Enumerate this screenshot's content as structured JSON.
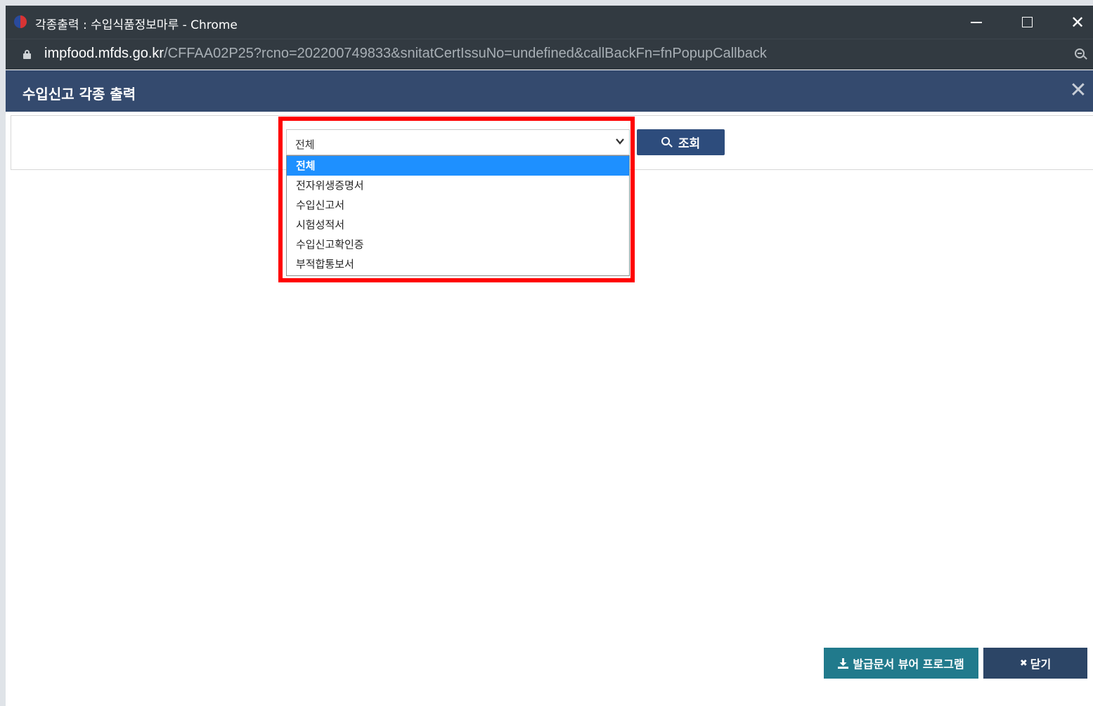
{
  "window": {
    "title": "각종출력 : 수입식품정보마루 - Chrome"
  },
  "addressbar": {
    "domain": "impfood.mfds.go.kr",
    "path": "/CFFAA02P25?rcno=202200749833&snitatCertIssuNo=undefined&callBackFn=fnPopupCallback"
  },
  "modal": {
    "title": "수입신고 각종 출력",
    "close_symbol": "✕"
  },
  "search": {
    "selected_value": "전체",
    "button_label": "조회",
    "options": [
      "전체",
      "전자위생증명서",
      "수입신고서",
      "시험성적서",
      "수입신고확인증",
      "부적합통보서"
    ],
    "highlighted_index": 0
  },
  "footer": {
    "viewer_button_label": "발급문서 뷰어 프로그램",
    "close_button_label": "닫기",
    "close_button_icon": "✖"
  },
  "colors": {
    "titlebar": "#323a41",
    "modal_header": "#344a6e",
    "search_button": "#2d4c7c",
    "viewer_button": "#217a8c",
    "close_button": "#2c4566",
    "highlight_border": "#ff0000",
    "selected_option": "#1e90ff"
  }
}
